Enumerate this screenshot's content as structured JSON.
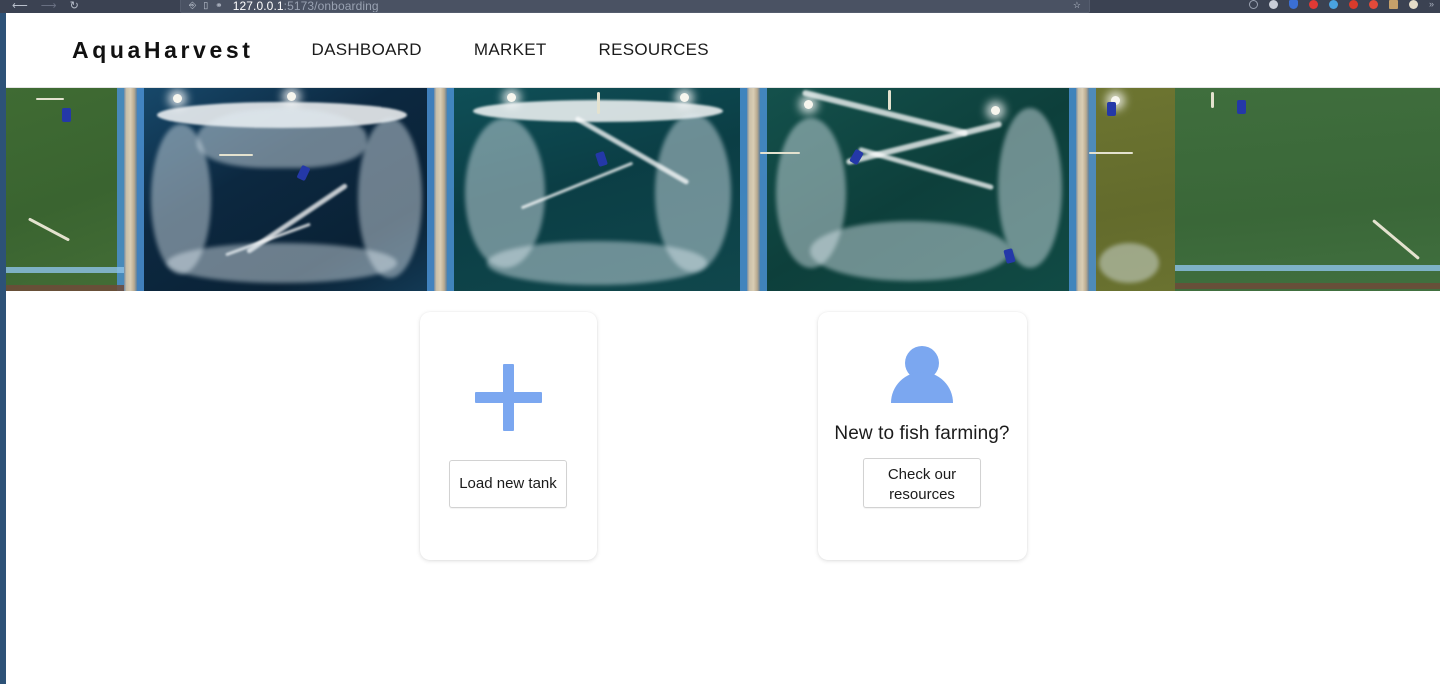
{
  "browser": {
    "back_icon": "back-arrow-icon",
    "forward_icon": "forward-arrow-icon",
    "reload_icon": "reload-icon",
    "shield_icon": "shield-icon",
    "reader_icon": "reader-view-icon",
    "key_icon": "key-icon",
    "bookmark_icon": "bookmark-star-icon",
    "url_host": "127.0.0.1",
    "url_path": ":5173/onboarding",
    "url_full": "127.0.0.1:5173/onboarding",
    "extensions": [
      {
        "name": "extension-icon-ring",
        "color": "#9aa2b1"
      },
      {
        "name": "extension-icon-gray",
        "color": "#c9ced8"
      },
      {
        "name": "extension-icon-blue",
        "color": "#3b6fd4"
      },
      {
        "name": "extension-icon-red",
        "color": "#e03a35"
      },
      {
        "name": "extension-icon-cyan",
        "color": "#4aa3e0"
      },
      {
        "name": "extension-icon-red2",
        "color": "#d93b2b"
      },
      {
        "name": "extension-icon-red3",
        "color": "#e24a3a"
      },
      {
        "name": "extension-icon-tan",
        "color": "#c5a06a"
      },
      {
        "name": "extension-icon-pale",
        "color": "#e5dcc8"
      }
    ],
    "overflow_label": "»"
  },
  "header": {
    "logo": "AquaHarvest",
    "nav": [
      {
        "label": "DASHBOARD"
      },
      {
        "label": "MARKET"
      },
      {
        "label": "RESOURCES"
      }
    ]
  },
  "hero": {
    "alt": "aerial-view-of-aquaculture-fish-ponds",
    "colors": {
      "deep_water": "#10364f",
      "teal_water": "#0e4b4a",
      "green_pond": "#3e6b2f",
      "olive_pond": "#6c7430",
      "foam": "#ffffff",
      "rim": "#4a8fd1",
      "divider": "#d9cdb4"
    }
  },
  "main": {
    "cards": [
      {
        "id": "load-tank",
        "icon": "plus-icon",
        "icon_color": "#7ba7f0",
        "heading": "",
        "button_label": "Load new tank"
      },
      {
        "id": "new-to-fish-farming",
        "icon": "person-icon",
        "icon_color": "#7ba7f0",
        "heading": "New to fish farming?",
        "button_label": "Check our resources"
      }
    ]
  }
}
